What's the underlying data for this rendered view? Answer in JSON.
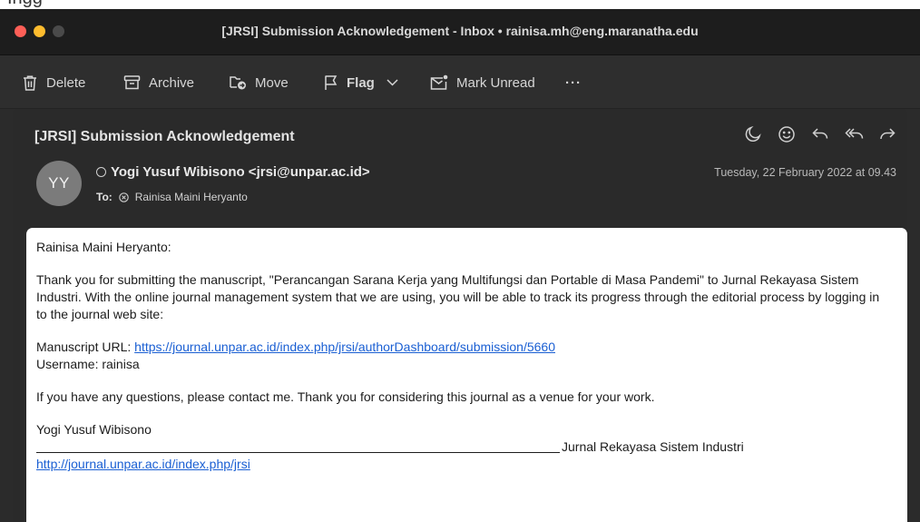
{
  "top_strip_text": "Ingg",
  "window": {
    "title": "[JRSI] Submission Acknowledgement - Inbox • rainisa.mh@eng.maranatha.edu"
  },
  "toolbar": {
    "delete_label": "Delete",
    "archive_label": "Archive",
    "move_label": "Move",
    "flag_label": "Flag",
    "mark_unread_label": "Mark Unread",
    "more_label": "···"
  },
  "message": {
    "subject": "[JRSI] Submission Acknowledgement",
    "avatar_initials": "YY",
    "sender": "Yogi Yusuf Wibisono <jrsi@unpar.ac.id>",
    "to_label": "To:",
    "recipient": "Rainisa Maini Heryanto",
    "date": "Tuesday, 22 February 2022 at 09.43"
  },
  "body": {
    "greeting": "Rainisa Maini Heryanto:",
    "paragraph1": "Thank you for submitting the manuscript, \"Perancangan Sarana Kerja yang Multifungsi dan Portable di Masa Pandemi\" to Jurnal Rekayasa Sistem Industri. With the online journal management system that we are using, you will be able to track its progress through the editorial process by logging in to the journal web site:",
    "manuscript_url_label": "Manuscript URL: ",
    "manuscript_url": "https://journal.unpar.ac.id/index.php/jrsi/authorDashboard/submission/5660",
    "username_line": "Username: rainisa",
    "paragraph2": "If you have any questions, please contact me. Thank you for considering this journal as a venue for your work.",
    "signature_name": "Yogi Yusuf Wibisono",
    "signature_journal": "Jurnal Rekayasa Sistem Industri",
    "journal_url": "http://journal.unpar.ac.id/index.php/jrsi"
  },
  "colors": {
    "close": "#fe5f57",
    "minimize": "#febc2e",
    "link": "#1a5fd3"
  },
  "icons": [
    "trash-icon",
    "archive-icon",
    "move-folder-icon",
    "flag-icon",
    "chevron-down-icon",
    "mark-unread-icon",
    "more-icon",
    "moon-icon",
    "smiley-icon",
    "reply-icon",
    "reply-all-icon",
    "forward-icon"
  ]
}
